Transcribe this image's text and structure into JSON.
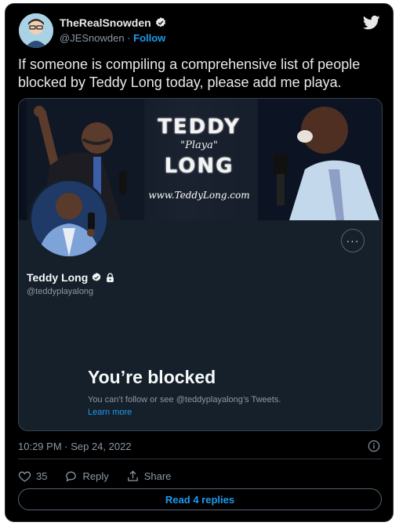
{
  "author": {
    "name": "TheRealSnowden",
    "handle": "@JESnowden",
    "separator": " · ",
    "follow_label": "Follow"
  },
  "tweet": {
    "text": "If someone is compiling a comprehensive list of people blocked by Teddy Long today, please add me playa.",
    "timestamp": "10:29 PM · Sep 24, 2022"
  },
  "card": {
    "banner": {
      "title_top": "TEDDY",
      "subtitle": "\"Playa\"",
      "title_bottom": "LONG",
      "url": "www.TeddyLong.com"
    },
    "more_label": "···",
    "profile_name": "Teddy Long",
    "profile_handle": "@teddyplayalong",
    "blocked_title": "You’re blocked",
    "blocked_description": "You can’t follow or see @teddyplayalong’s Tweets.",
    "learn_more": "Learn more"
  },
  "actions": {
    "likes_count": "35",
    "reply_label": "Reply",
    "share_label": "Share"
  },
  "read_replies_label": "Read 4 replies",
  "icons": {
    "brand": "twitter-bird-icon",
    "verified": "verified-badge-icon",
    "protected": "lock-icon",
    "like": "heart-icon",
    "reply": "reply-bubble-icon",
    "share": "share-icon",
    "info": "info-icon"
  },
  "colors": {
    "background": "#000000",
    "card_background": "#15202b",
    "accent": "#1d9bf0",
    "muted_text": "#8b98a5",
    "primary_text": "#e7e9ea"
  }
}
